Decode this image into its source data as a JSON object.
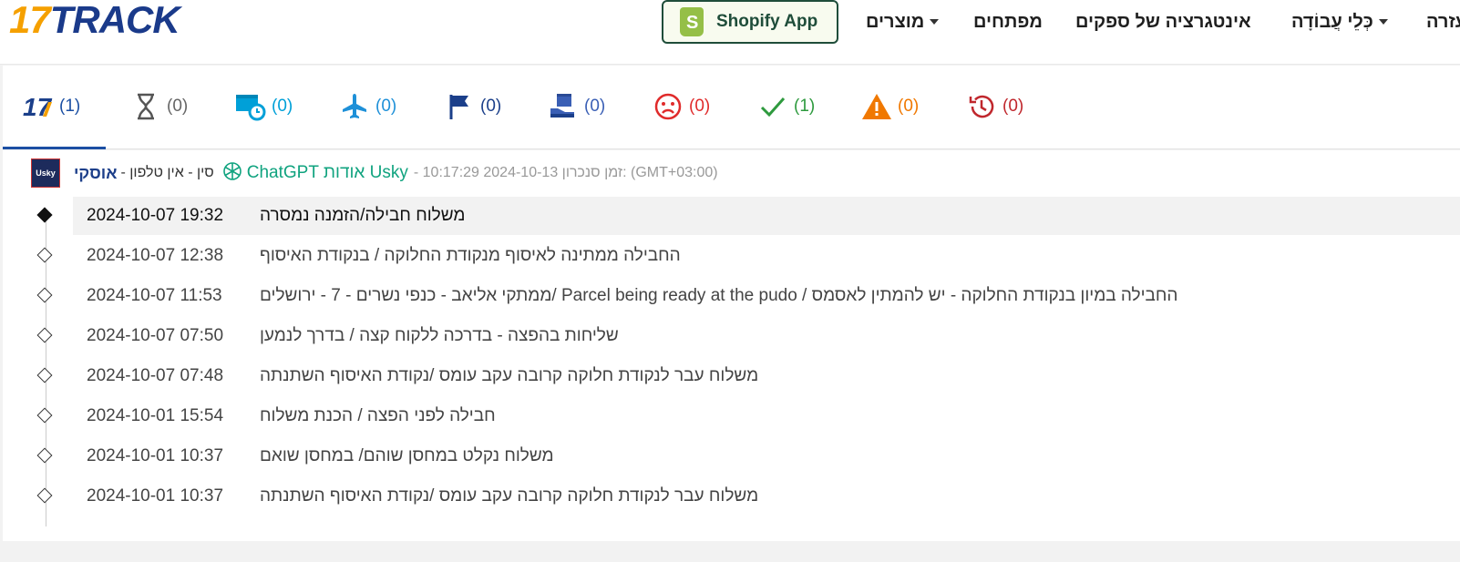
{
  "header": {
    "logo_number": "17",
    "logo_text": "TRACK",
    "shopify_label": "Shopify App",
    "nav": {
      "products": "מוצרים",
      "developers": "מפתחים",
      "integration": "אינטגרציה של ספקים",
      "tools": "כְּלֵי עֲבוֹדָה",
      "help": "עזרה"
    }
  },
  "tabs": [
    {
      "name": "all",
      "count": "(1)",
      "color": "#1b4fa3"
    },
    {
      "name": "not-found",
      "count": "(0)",
      "color": "#666666"
    },
    {
      "name": "info-received",
      "count": "(0)",
      "color": "#00a0d8"
    },
    {
      "name": "in-transit",
      "count": "(0)",
      "color": "#1e90d8"
    },
    {
      "name": "pick-up",
      "count": "(0)",
      "color": "#1b4fa3"
    },
    {
      "name": "out-for-delivery",
      "count": "(0)",
      "color": "#3a5fb5"
    },
    {
      "name": "undelivered",
      "count": "(0)",
      "color": "#e02b2b"
    },
    {
      "name": "delivered",
      "count": "(1)",
      "color": "#2e9a3e"
    },
    {
      "name": "alert",
      "count": "(0)",
      "color": "#f07800"
    },
    {
      "name": "expired",
      "count": "(0)",
      "color": "#c0272d"
    }
  ],
  "carrier": {
    "logo_text": "Usky",
    "name": "אוסקי",
    "meta": "- סין - אין טלפון",
    "gpt_link": "ChatGPT אודות Usky",
    "sync": "- 10:17:29 2024-10-13 זמן סנכרון: (GMT+03:00)"
  },
  "events": [
    {
      "time": "2024-10-07 19:32",
      "desc": "משלוח חבילה/הזמנה נמסרה"
    },
    {
      "time": "2024-10-07 12:38",
      "desc": "החבילה ממתינה לאיסוף מנקודת החלוקה / בנקודת האיסוף"
    },
    {
      "time": "2024-10-07 11:53",
      "desc": "ממתקי אליאב - כנפי נשרים - 7 - ירושלים/ Parcel being ready at the pudo / החבילה במיון בנקודת החלוקה - יש להמתין לאסמס"
    },
    {
      "time": "2024-10-07 07:50",
      "desc": "שליחות בהפצה - בדרכה ללקוח קצה / בדרך לנמען"
    },
    {
      "time": "2024-10-07 07:48",
      "desc": "משלוח עבר לנקודת חלוקה קרובה עקב עומס /נקודת האיסוף השתנתה"
    },
    {
      "time": "2024-10-01 15:54",
      "desc": "חבילה לפני הפצה / הכנת משלוח"
    },
    {
      "time": "2024-10-01 10:37",
      "desc": "משלוח נקלט במחסן שוהם/ במחסן שואם"
    },
    {
      "time": "2024-10-01 10:37",
      "desc": "משלוח עבר לנקודת חלוקה קרובה עקב עומס /נקודת האיסוף השתנתה"
    }
  ]
}
